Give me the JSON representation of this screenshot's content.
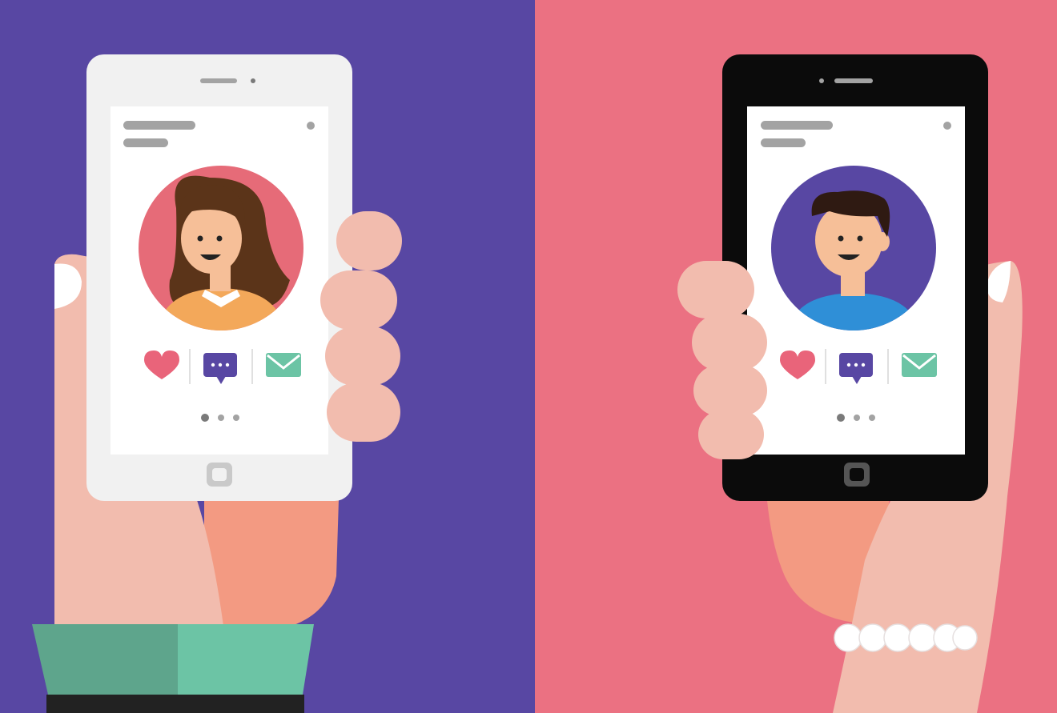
{
  "colors": {
    "left_background": "#5847a3",
    "right_background": "#eb7182",
    "skin": "#f2bcae",
    "skin_shadow": "#f39a82",
    "skin_outline": "#d9d4d8",
    "nail": "#ffffff",
    "white_phone": "#f1f1f1",
    "black_phone": "#0b0b0b",
    "screen": "#ffffff",
    "placeholder_bar": "#a3a3a3",
    "woman_avatar_bg": "#e66b78",
    "man_avatar_bg": "#5847a3",
    "hair_woman": "#5b3419",
    "hair_man": "#2f1a12",
    "face": "#f6bf98",
    "woman_top": "#f3a85a",
    "man_top": "#2f8fd7",
    "heart": "#e9647a",
    "chat": "#5847a3",
    "mail": "#6cc4a5",
    "sleeve_dark": "#5ea58c",
    "sleeve_light": "#6cc4a5",
    "pearl": "#ffffff"
  },
  "phones": [
    {
      "name": "white-phone",
      "avatar": "woman",
      "actions": [
        "heart-icon",
        "chat-icon",
        "mail-icon"
      ],
      "pager": {
        "pages": 3,
        "active": 1
      }
    },
    {
      "name": "black-phone",
      "avatar": "man",
      "actions": [
        "heart-icon",
        "chat-icon",
        "mail-icon"
      ],
      "pager": {
        "pages": 3,
        "active": 1
      }
    }
  ],
  "accessories": {
    "left_hand": "green-sleeve-cuff",
    "right_hand": "pearl-bracelet"
  }
}
